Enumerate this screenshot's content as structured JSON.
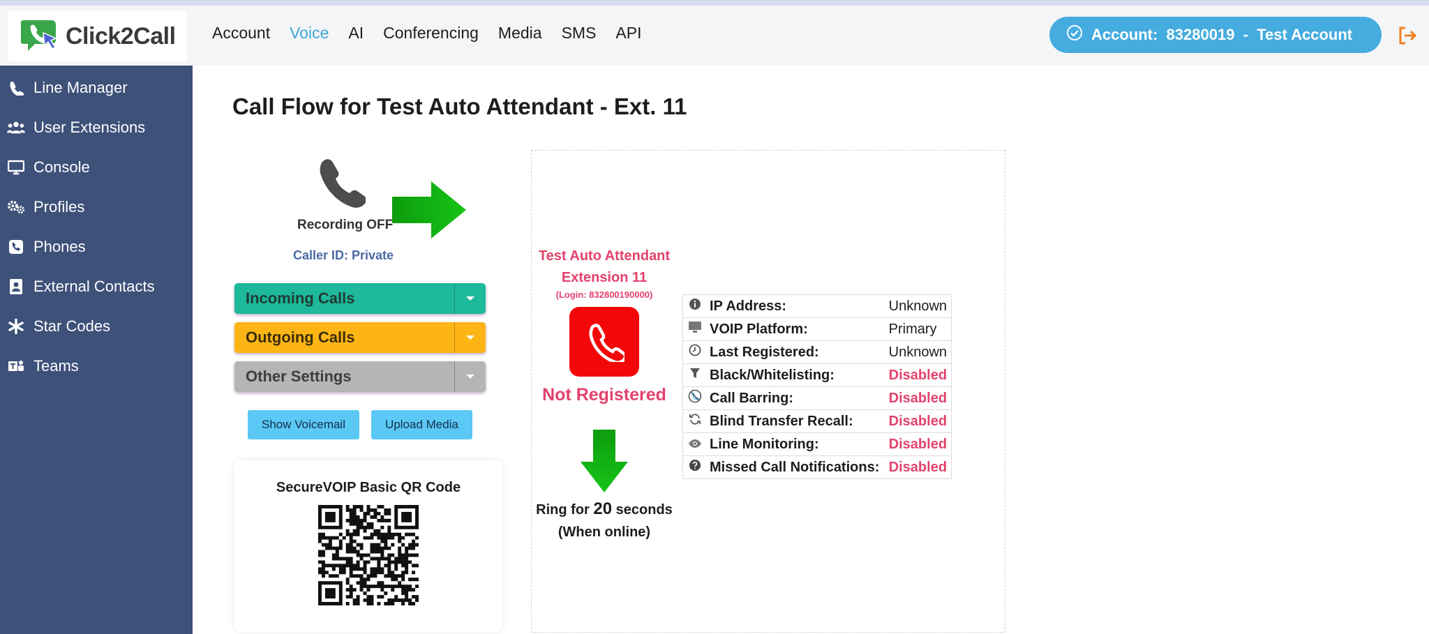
{
  "brand": {
    "name": "Click2Call"
  },
  "nav": {
    "items": [
      "Account",
      "Voice",
      "AI",
      "Conferencing",
      "Media",
      "SMS",
      "API"
    ],
    "active": "Voice"
  },
  "account": {
    "label": "Account:  83280019  -  Test Account"
  },
  "sidebar": {
    "items": [
      {
        "label": "Line Manager",
        "icon": "phone-icon"
      },
      {
        "label": "User Extensions",
        "icon": "users-icon"
      },
      {
        "label": "Console",
        "icon": "monitor-icon"
      },
      {
        "label": "Profiles",
        "icon": "gears-icon"
      },
      {
        "label": "Phones",
        "icon": "phone-square-icon"
      },
      {
        "label": "External Contacts",
        "icon": "contact-card-icon"
      },
      {
        "label": "Star Codes",
        "icon": "asterisk-icon"
      },
      {
        "label": "Teams",
        "icon": "teams-icon"
      }
    ]
  },
  "page": {
    "title": "Call Flow for Test Auto Attendant - Ext. 11"
  },
  "left": {
    "recording": "Recording OFF",
    "caller_id": "Caller ID: Private",
    "dropdowns": [
      {
        "label": "Incoming Calls",
        "color": "#1db99a"
      },
      {
        "label": "Outgoing Calls",
        "color": "#fdb515"
      },
      {
        "label": "Other Settings",
        "color": "#b5b5b5"
      }
    ],
    "show_voicemail": "Show Voicemail",
    "upload_media": "Upload Media",
    "qr_title": "SecureVOIP Basic QR Code"
  },
  "extension": {
    "name": "Test Auto Attendant",
    "number": "Extension 11",
    "login": "(Login: 832800190000)",
    "status": "Not Registered",
    "ring_prefix": "Ring for",
    "ring_seconds": "20",
    "ring_suffix": "seconds",
    "ring_note": "(When online)"
  },
  "details": [
    {
      "icon": "info-icon",
      "label": "IP Address:",
      "value": "Unknown",
      "disabled": false
    },
    {
      "icon": "monitor-icon",
      "label": "VOIP Platform:",
      "value": "Primary",
      "disabled": false
    },
    {
      "icon": "clock-icon",
      "label": "Last Registered:",
      "value": "Unknown",
      "disabled": false
    },
    {
      "icon": "filter-icon",
      "label": "Black/Whitelisting:",
      "value": "Disabled",
      "disabled": true
    },
    {
      "icon": "barred-phone-icon",
      "label": "Call Barring:",
      "value": "Disabled",
      "disabled": true
    },
    {
      "icon": "refresh-icon",
      "label": "Blind Transfer Recall:",
      "value": "Disabled",
      "disabled": true
    },
    {
      "icon": "eye-icon",
      "label": "Line Monitoring:",
      "value": "Disabled",
      "disabled": true
    },
    {
      "icon": "question-icon",
      "label": "Missed Call Notifications:",
      "value": "Disabled",
      "disabled": true
    }
  ],
  "colors": {
    "sidebar": "#3d5179",
    "accent": "#3ea5dc",
    "alert": "#e2426c",
    "arrow": "#1fa81f"
  }
}
